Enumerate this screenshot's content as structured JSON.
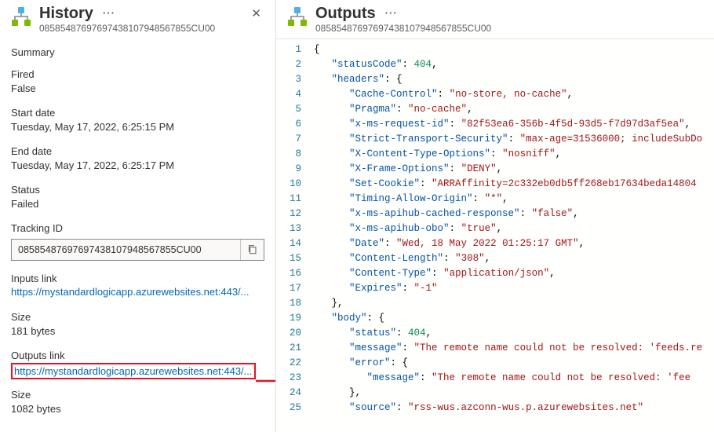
{
  "history": {
    "title": "History",
    "run_id": "08585487697697438107948567855CU00",
    "summary_label": "Summary",
    "fired": {
      "label": "Fired",
      "value": "False"
    },
    "start": {
      "label": "Start date",
      "value": "Tuesday, May 17, 2022, 6:25:15 PM"
    },
    "end": {
      "label": "End date",
      "value": "Tuesday, May 17, 2022, 6:25:17 PM"
    },
    "status": {
      "label": "Status",
      "value": "Failed"
    },
    "tracking": {
      "label": "Tracking ID",
      "value": "08585487697697438107948567855CU00"
    },
    "inputs": {
      "label": "Inputs link",
      "link": "https://mystandardlogicapp.azurewebsites.net:443/...",
      "size_label": "Size",
      "size_value": "181 bytes"
    },
    "outputs": {
      "label": "Outputs link",
      "link": "https://mystandardlogicapp.azurewebsites.net:443/...",
      "size_label": "Size",
      "size_value": "1082 bytes"
    }
  },
  "outputs_panel": {
    "title": "Outputs",
    "run_id": "08585487697697438107948567855CU00"
  },
  "code": {
    "lines": [
      [
        [
          "brace",
          "{"
        ]
      ],
      [
        [
          "indent",
          1
        ],
        [
          "key",
          "\"statusCode\""
        ],
        [
          "punct",
          ": "
        ],
        [
          "number",
          "404"
        ],
        [
          "punct",
          ","
        ]
      ],
      [
        [
          "indent",
          1
        ],
        [
          "key",
          "\"headers\""
        ],
        [
          "punct",
          ": "
        ],
        [
          "brace",
          "{"
        ]
      ],
      [
        [
          "indent",
          2
        ],
        [
          "key",
          "\"Cache-Control\""
        ],
        [
          "punct",
          ": "
        ],
        [
          "string",
          "\"no-store, no-cache\""
        ],
        [
          "punct",
          ","
        ]
      ],
      [
        [
          "indent",
          2
        ],
        [
          "key",
          "\"Pragma\""
        ],
        [
          "punct",
          ": "
        ],
        [
          "string",
          "\"no-cache\""
        ],
        [
          "punct",
          ","
        ]
      ],
      [
        [
          "indent",
          2
        ],
        [
          "key",
          "\"x-ms-request-id\""
        ],
        [
          "punct",
          ": "
        ],
        [
          "string",
          "\"82f53ea6-356b-4f5d-93d5-f7d97d3af5ea\""
        ],
        [
          "punct",
          ","
        ]
      ],
      [
        [
          "indent",
          2
        ],
        [
          "key",
          "\"Strict-Transport-Security\""
        ],
        [
          "punct",
          ": "
        ],
        [
          "string",
          "\"max-age=31536000; includeSubDo"
        ]
      ],
      [
        [
          "indent",
          2
        ],
        [
          "key",
          "\"X-Content-Type-Options\""
        ],
        [
          "punct",
          ": "
        ],
        [
          "string",
          "\"nosniff\""
        ],
        [
          "punct",
          ","
        ]
      ],
      [
        [
          "indent",
          2
        ],
        [
          "key",
          "\"X-Frame-Options\""
        ],
        [
          "punct",
          ": "
        ],
        [
          "string",
          "\"DENY\""
        ],
        [
          "punct",
          ","
        ]
      ],
      [
        [
          "indent",
          2
        ],
        [
          "key",
          "\"Set-Cookie\""
        ],
        [
          "punct",
          ": "
        ],
        [
          "string",
          "\"ARRAffinity=2c332eb0db5ff268eb17634beda14804"
        ]
      ],
      [
        [
          "indent",
          2
        ],
        [
          "key",
          "\"Timing-Allow-Origin\""
        ],
        [
          "punct",
          ": "
        ],
        [
          "string",
          "\"*\""
        ],
        [
          "punct",
          ","
        ]
      ],
      [
        [
          "indent",
          2
        ],
        [
          "key",
          "\"x-ms-apihub-cached-response\""
        ],
        [
          "punct",
          ": "
        ],
        [
          "string",
          "\"false\""
        ],
        [
          "punct",
          ","
        ]
      ],
      [
        [
          "indent",
          2
        ],
        [
          "key",
          "\"x-ms-apihub-obo\""
        ],
        [
          "punct",
          ": "
        ],
        [
          "string",
          "\"true\""
        ],
        [
          "punct",
          ","
        ]
      ],
      [
        [
          "indent",
          2
        ],
        [
          "key",
          "\"Date\""
        ],
        [
          "punct",
          ": "
        ],
        [
          "string",
          "\"Wed, 18 May 2022 01:25:17 GMT\""
        ],
        [
          "punct",
          ","
        ]
      ],
      [
        [
          "indent",
          2
        ],
        [
          "key",
          "\"Content-Length\""
        ],
        [
          "punct",
          ": "
        ],
        [
          "string",
          "\"308\""
        ],
        [
          "punct",
          ","
        ]
      ],
      [
        [
          "indent",
          2
        ],
        [
          "key",
          "\"Content-Type\""
        ],
        [
          "punct",
          ": "
        ],
        [
          "string",
          "\"application/json\""
        ],
        [
          "punct",
          ","
        ]
      ],
      [
        [
          "indent",
          2
        ],
        [
          "key",
          "\"Expires\""
        ],
        [
          "punct",
          ": "
        ],
        [
          "string",
          "\"-1\""
        ]
      ],
      [
        [
          "indent",
          1
        ],
        [
          "brace",
          "}"
        ],
        [
          "punct",
          ","
        ]
      ],
      [
        [
          "indent",
          1
        ],
        [
          "key",
          "\"body\""
        ],
        [
          "punct",
          ": "
        ],
        [
          "brace",
          "{"
        ]
      ],
      [
        [
          "indent",
          2
        ],
        [
          "key",
          "\"status\""
        ],
        [
          "punct",
          ": "
        ],
        [
          "number",
          "404"
        ],
        [
          "punct",
          ","
        ]
      ],
      [
        [
          "indent",
          2
        ],
        [
          "key",
          "\"message\""
        ],
        [
          "punct",
          ": "
        ],
        [
          "string",
          "\"The remote name could not be resolved: 'feeds.re"
        ]
      ],
      [
        [
          "indent",
          2
        ],
        [
          "key",
          "\"error\""
        ],
        [
          "punct",
          ": "
        ],
        [
          "brace",
          "{"
        ]
      ],
      [
        [
          "indent",
          3
        ],
        [
          "key",
          "\"message\""
        ],
        [
          "punct",
          ": "
        ],
        [
          "string",
          "\"The remote name could not be resolved: 'fee"
        ]
      ],
      [
        [
          "indent",
          2
        ],
        [
          "brace",
          "}"
        ],
        [
          "punct",
          ","
        ]
      ],
      [
        [
          "indent",
          2
        ],
        [
          "key",
          "\"source\""
        ],
        [
          "punct",
          ": "
        ],
        [
          "string",
          "\"rss-wus.azconn-wus.p.azurewebsites.net\""
        ]
      ]
    ]
  }
}
